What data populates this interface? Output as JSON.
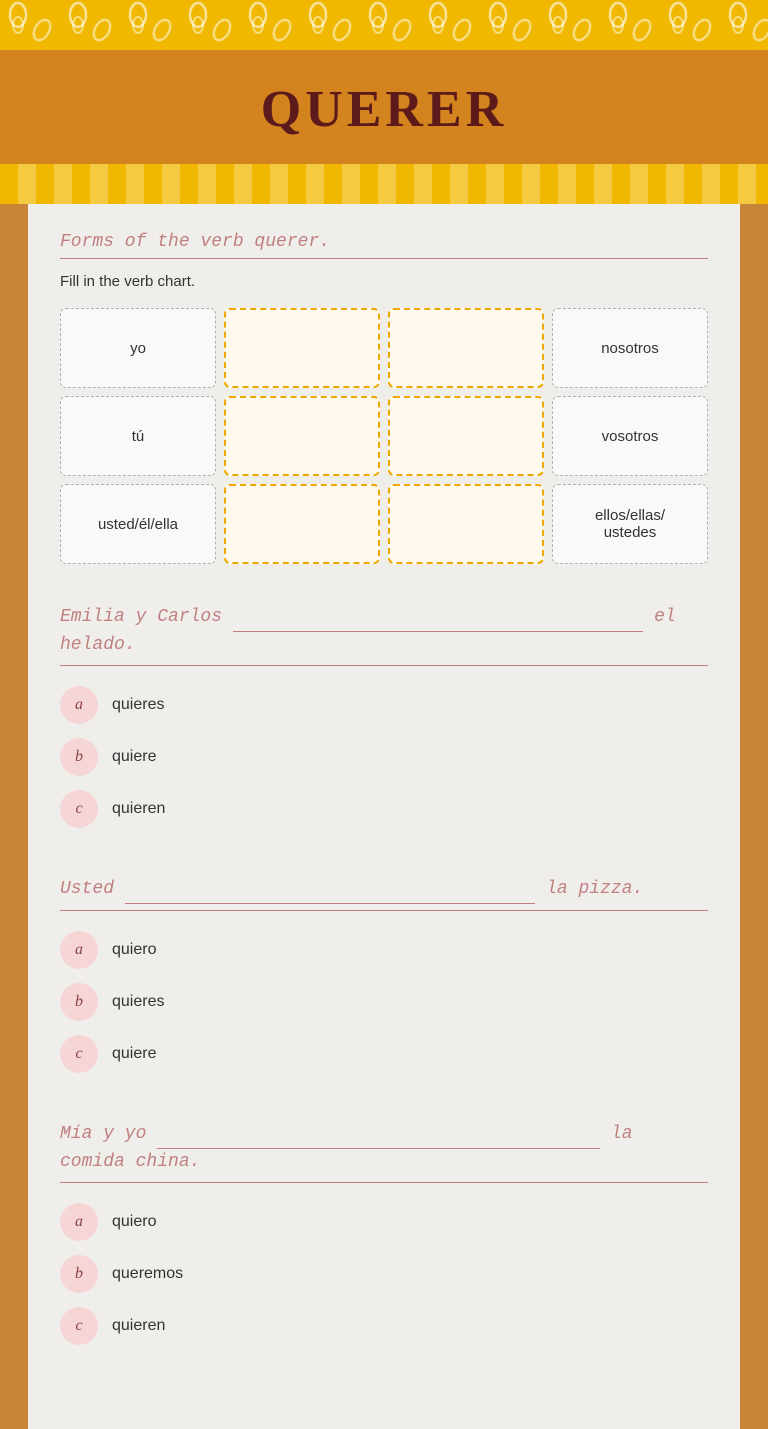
{
  "header": {
    "title": "QUERER"
  },
  "verb_chart": {
    "section_title": "Forms of the verb querer.",
    "instruction": "Fill in the verb chart.",
    "cells": [
      {
        "type": "label",
        "text": "yo"
      },
      {
        "type": "input",
        "text": ""
      },
      {
        "type": "input",
        "text": ""
      },
      {
        "type": "label",
        "text": "nosotros"
      },
      {
        "type": "label",
        "text": "tú"
      },
      {
        "type": "input",
        "text": ""
      },
      {
        "type": "input",
        "text": ""
      },
      {
        "type": "label",
        "text": "vosotros"
      },
      {
        "type": "label",
        "text": "usted/él/ella"
      },
      {
        "type": "input",
        "text": ""
      },
      {
        "type": "input",
        "text": ""
      },
      {
        "type": "label",
        "text": "ellos/ellas/\nustedes"
      }
    ]
  },
  "questions": [
    {
      "id": "q1",
      "text_before": "Emilia y Carlos",
      "blank": true,
      "text_after": "el helado.",
      "options": [
        {
          "badge": "a",
          "text": "quieres"
        },
        {
          "badge": "b",
          "text": "quiere"
        },
        {
          "badge": "c",
          "text": "quieren"
        }
      ]
    },
    {
      "id": "q2",
      "text_before": "Usted",
      "blank": true,
      "text_after": "la pizza.",
      "options": [
        {
          "badge": "a",
          "text": "quiero"
        },
        {
          "badge": "b",
          "text": "quieres"
        },
        {
          "badge": "c",
          "text": "quiere"
        }
      ]
    },
    {
      "id": "q3",
      "text_before": "Mía y yo",
      "blank": true,
      "text_after": "la comida china.",
      "options": [
        {
          "badge": "a",
          "text": "quiero"
        },
        {
          "badge": "b",
          "text": "queremos"
        },
        {
          "badge": "c",
          "text": "quieren"
        }
      ]
    }
  ]
}
